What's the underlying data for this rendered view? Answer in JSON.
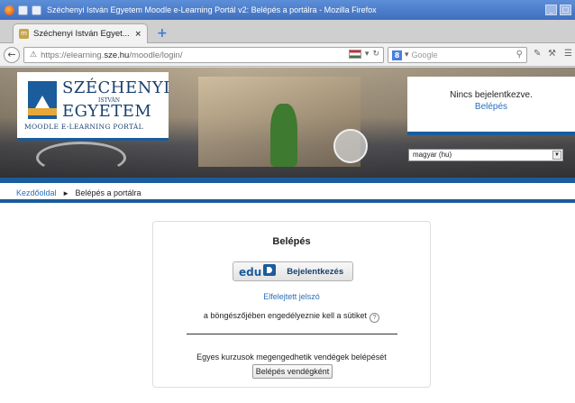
{
  "window": {
    "title": "Széchenyi István Egyetem Moodle e-Learning Portál v2: Belépés a portálra - Mozilla Firefox"
  },
  "tab": {
    "label": "Széchenyi István Egyet...",
    "close": "×",
    "new_tab": "+"
  },
  "nav": {
    "url_prefix": "https://elearning.",
    "url_domain": "sze.hu",
    "url_suffix": "/moodle/login/",
    "search_placeholder": "Google",
    "search_engine_letter": "8"
  },
  "logo": {
    "line1": "SZÉCHENYI",
    "line2": "ISTVÁN",
    "line3": "EGYETEM",
    "line4": "MOODLE E-LEARNING PORTÁL"
  },
  "login_box": {
    "status": "Nincs bejelentkezve.",
    "link": "Belépés"
  },
  "language": {
    "selected": "magyar (hu)"
  },
  "breadcrumb": {
    "home": "Kezdőoldal",
    "separator": "►",
    "current": "Belépés a portálra"
  },
  "card": {
    "title": "Belépés",
    "eduid_edu": "edu",
    "eduid_button": "Bejelentkezés",
    "forgot": "Elfelejtett jelszó",
    "cookie_note": "a böngészőjében engedélyeznie kell a sütiket",
    "guest_note": "Egyes kurzusok megengedhetik vendégek belépését",
    "guest_button": "Belépés vendégként"
  },
  "colors": {
    "brand_blue": "#1a5c9c",
    "link_blue": "#2a6ebb"
  },
  "icons": [
    "firefox-icon",
    "window-menu-icon",
    "back-arrow-icon",
    "warning-icon",
    "flag-hu-icon",
    "reload-icon",
    "search-icon",
    "help-icon",
    "eduid-logo-icon"
  ]
}
